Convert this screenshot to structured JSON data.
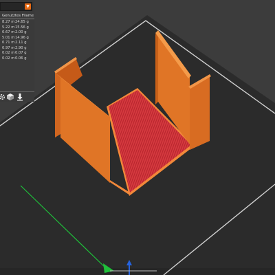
{
  "legend": {
    "dropdown_value": "",
    "header": "Genutztes Filament",
    "rows": [
      {
        "length": "8.27 m",
        "weight": "24.65 g"
      },
      {
        "length": "5.22 m",
        "weight": "15.56 g"
      },
      {
        "length": "0.67 m",
        "weight": "2.00 g"
      },
      {
        "length": "5.01 m",
        "weight": "14.96 g"
      },
      {
        "length": "0.71 m",
        "weight": "2.11 g"
      },
      {
        "length": "0.97 m",
        "weight": "2.90 g"
      },
      {
        "length": "0.02 m",
        "weight": "0.07 g"
      },
      {
        "length": "0.02 m",
        "weight": "0.06 g"
      }
    ]
  },
  "toolbar": {
    "icons": [
      "gear-icon",
      "view-cube-icon",
      "export-icon"
    ]
  },
  "colors": {
    "background": "#3b3b3b",
    "bed": "#2a2a2a",
    "wall": "#e07228",
    "floor_infill": "#d8363c",
    "accent": "#e76a14",
    "axis_x": "#1fbf3a",
    "axis_y": "#2563e0"
  }
}
